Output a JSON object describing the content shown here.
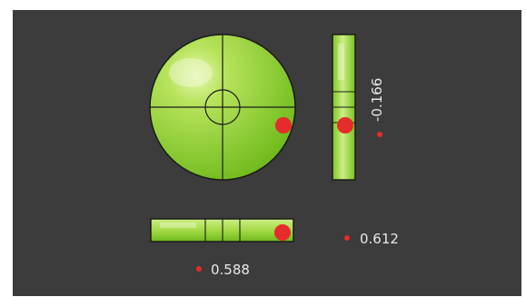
{
  "colors": {
    "background": "#3c3c3c",
    "bubble": "#e52b2b",
    "level_green_light": "#c7ea72",
    "level_green_dark": "#6cb91a",
    "outline": "#1b1b1b",
    "text": "#e8e8e8"
  },
  "readouts": {
    "vertical_value": "-0.166",
    "horizontal_value": "0.612",
    "bottom_value": "0.588"
  },
  "icons": {
    "circle_level": "bullseye-level-icon",
    "vertical_level": "vertical-bubble-vial-icon",
    "horizontal_level": "horizontal-bubble-vial-icon",
    "marker": "red-dot-icon"
  }
}
